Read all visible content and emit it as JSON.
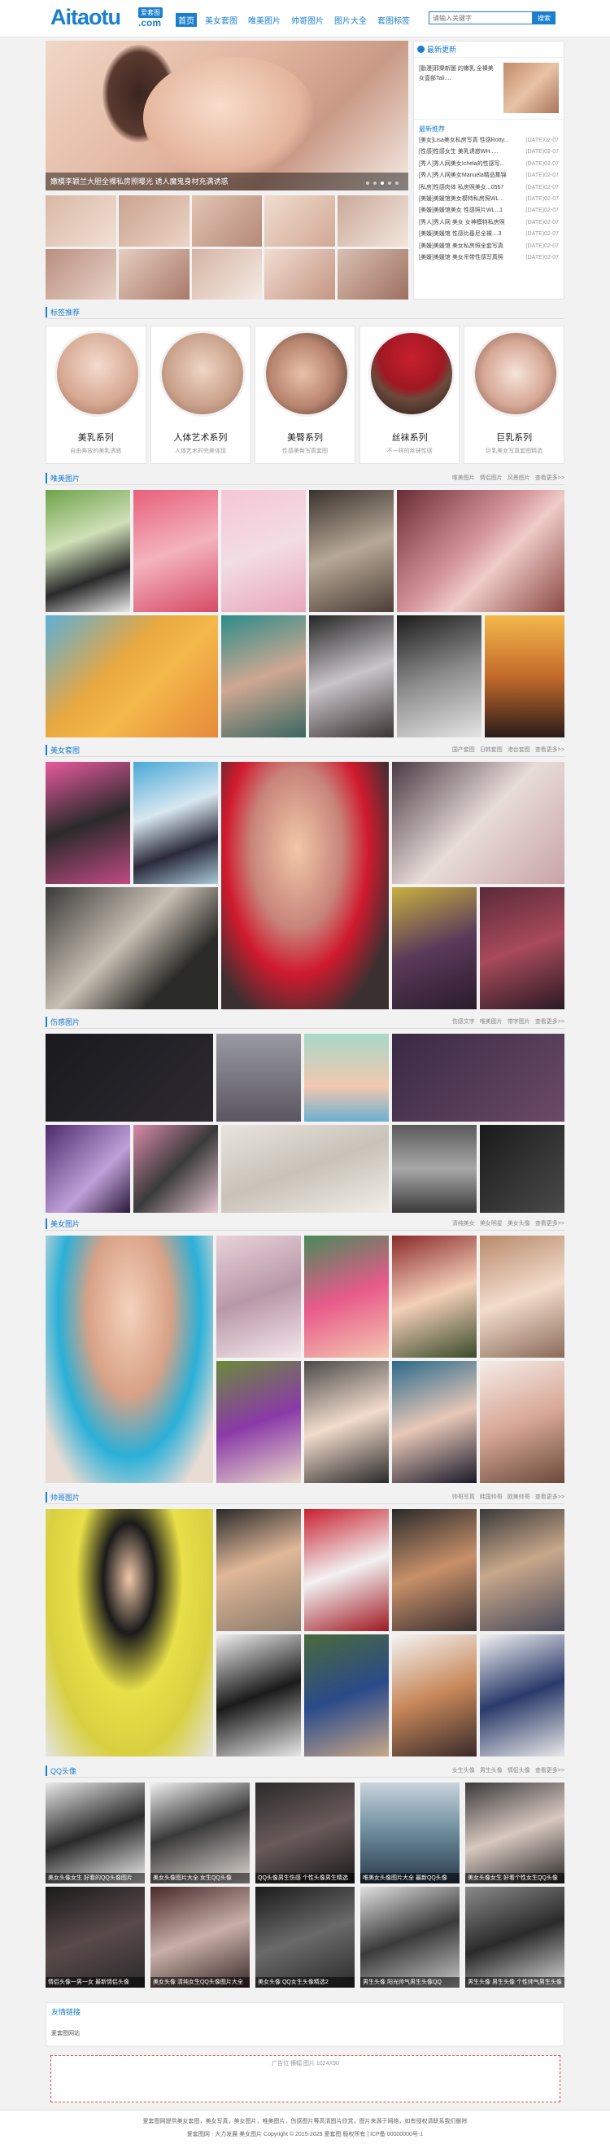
{
  "header": {
    "logo_main": "Aitaotu",
    "logo_badge": "爱套图",
    "logo_com": ".com",
    "nav": [
      "首页",
      "美女套图",
      "唯美图片",
      "帅哥图片",
      "图片大全",
      "套图标签"
    ],
    "search_placeholder": "请输入关键字",
    "search_button": "搜索"
  },
  "banner": {
    "caption": "嫩模李颖兰大胆全裸私房照曝光 诱人魔鬼身材充满诱惑"
  },
  "sidebar": {
    "title": "最新更新",
    "feature_text": "[動漫]邪樂新圖 的嫩乳 全裸美女壹部Tali....",
    "hot_title": "最新推荐",
    "items": [
      {
        "title": "[美女]Lisa美女私房写真 性感Rotty...",
        "date": "(DATE)02-07"
      },
      {
        "title": "[性感]性感女生 美乳诱惑WH.....",
        "date": "(DATE)02-07"
      },
      {
        "title": "[秀人]秀人网美女Ichela的性感写...",
        "date": "(DATE)02-07"
      },
      {
        "title": "[秀人]秀人网美女Manuela精品集锦",
        "date": "(DATE)02-07"
      },
      {
        "title": "[私房]性感肉体 私房照美女...0567",
        "date": "(DATE)02-07"
      },
      {
        "title": "[美媛]美媛馆美女模特私房照WL...",
        "date": "(DATE)02-07"
      },
      {
        "title": "[美媛]美媛馆美女 性感照片WL...1",
        "date": "(DATE)02-07"
      },
      {
        "title": "[秀人]秀人网 美女 女神模特私房照",
        "date": "(DATE)02-07"
      },
      {
        "title": "[美媛]美媛馆 性感比基尼全裸....3",
        "date": "(DATE)02-07"
      },
      {
        "title": "[美媛]美媛馆 美女私房照全套写真",
        "date": "(DATE)02-07"
      },
      {
        "title": "[美媛]美媛馆 美女吊带性感写真照",
        "date": "(DATE)02-07"
      }
    ]
  },
  "sections": {
    "tags": {
      "title": "标签推荐"
    },
    "weimei": {
      "title": "唯美图片",
      "more": [
        "唯美图片",
        "情侣图片",
        "风景图片",
        "查看更多>>"
      ]
    },
    "taotu": {
      "title": "美女套图",
      "more": [
        "国产套图",
        "日韩套图",
        "港台套图",
        "查看更多>>"
      ]
    },
    "shanggan": {
      "title": "伤感图片",
      "more": [
        "伤感文字",
        "唯美图片",
        "带字图片",
        "查看更多>>"
      ]
    },
    "meinv": {
      "title": "美女图片",
      "more": [
        "清纯美女",
        "美女明星",
        "美女头像",
        "查看更多>>"
      ]
    },
    "shuaige": {
      "title": "帅哥图片",
      "more": [
        "帅哥写真",
        "韩国帅哥",
        "欧美帅哥",
        "查看更多>>"
      ]
    },
    "qq": {
      "title": "QQ头像",
      "more": [
        "女生头像",
        "男生头像",
        "情侣头像",
        "查看更多>>"
      ]
    }
  },
  "cards": [
    {
      "name": "美乳系列",
      "desc": "自由奔放的美乳诱惑"
    },
    {
      "name": "人体艺术系列",
      "desc": "人体艺术的完美体现"
    },
    {
      "name": "美臀系列",
      "desc": "性感美臀写真套图"
    },
    {
      "name": "丝袜系列",
      "desc": "不一样的丝袜性感"
    },
    {
      "name": "巨乳系列",
      "desc": "巨乳美女写真套图精选"
    }
  ],
  "qq_captions": [
    "美女头像女生 好看的QQ头像图片",
    "美女头像图片大全 女生QQ头像",
    "QQ头像男生伤感 个性头像男生精选",
    "唯美女头像图片大全 最新QQ头像",
    "美女头像女生 好看个性女生QQ头像",
    "情侣头像一男一女 最新情侣头像",
    "美女头像 清纯女生QQ头像图片大全",
    "美女头像 QQ女生头像精选2",
    "男生头像 阳光帅气男生头像QQ",
    "男生头像 男生头像 个性帅气男生头像"
  ],
  "links": {
    "title": "友情链接",
    "item": "爱套图网站"
  },
  "ad": {
    "text": "广告位 横幅 图片 1024X90"
  },
  "footer": {
    "line1": "爱套图网提供美女套图，美女写真，美女图片，唯美图片，伤感图片等高清图片欣赏，图片来源于网络，如有侵权请联系我们删除",
    "line2": "爱套图网 - 大力发展 美女图片  Copyright © 2015-2025 爱套图 版权所有 | ICP备 00000000号-1"
  },
  "colors": {
    "accent": "#1a7fcf",
    "ad_border": "#e24a4a"
  }
}
